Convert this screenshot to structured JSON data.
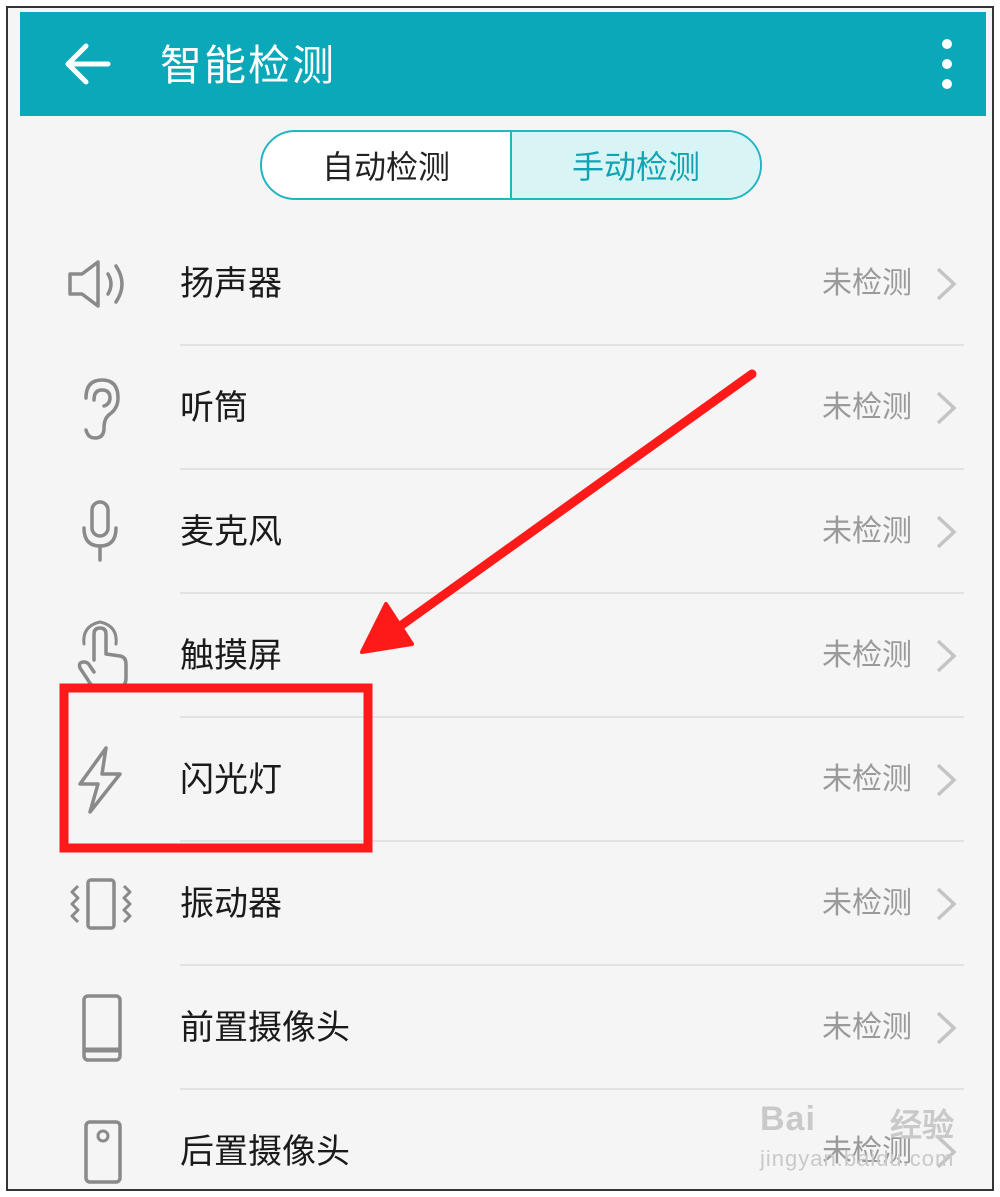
{
  "app_bar": {
    "title": "智能检测",
    "accent_color": "#0aa8b8",
    "back_icon": "back-arrow-icon",
    "more_icon": "more-vertical-icon"
  },
  "segmented_control": {
    "tabs": [
      {
        "label": "自动检测",
        "selected": false
      },
      {
        "label": "手动检测",
        "selected": true
      }
    ]
  },
  "items": [
    {
      "label": "扬声器",
      "status": "未检测",
      "icon": "speaker-icon"
    },
    {
      "label": "听筒",
      "status": "未检测",
      "icon": "earpiece-icon"
    },
    {
      "label": "麦克风",
      "status": "未检测",
      "icon": "microphone-icon"
    },
    {
      "label": "触摸屏",
      "status": "未检测",
      "icon": "touchscreen-icon"
    },
    {
      "label": "闪光灯",
      "status": "未检测",
      "icon": "flash-icon",
      "highlighted": true
    },
    {
      "label": "振动器",
      "status": "未检测",
      "icon": "vibration-icon"
    },
    {
      "label": "前置摄像头",
      "status": "未检测",
      "icon": "front-camera-icon"
    },
    {
      "label": "后置摄像头",
      "status": "未检测",
      "icon": "rear-camera-icon"
    }
  ],
  "annotation": {
    "color": "#ff1a1a",
    "arrow_target": "闪光灯"
  },
  "watermark": {
    "brand": "Bai",
    "brand_cn": "经验",
    "url": "jingyan.baidu.com"
  }
}
